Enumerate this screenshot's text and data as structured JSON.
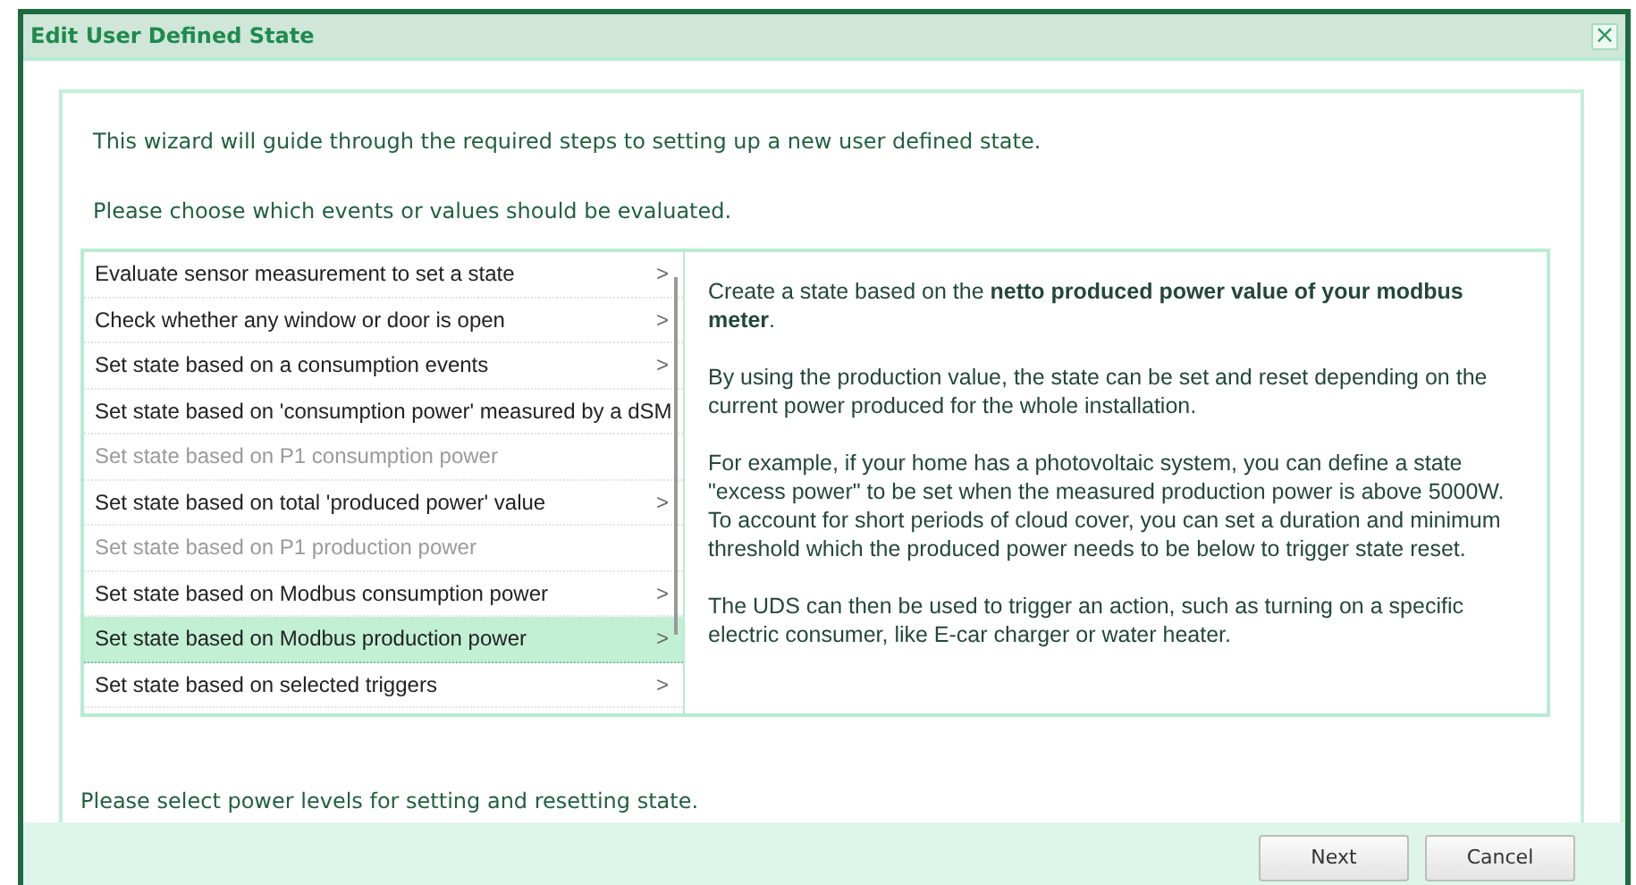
{
  "window": {
    "title": "Edit User Defined State",
    "close": "×"
  },
  "intro": "This wizard will guide through the required steps to setting up a new user defined state.",
  "prompt": "Please choose which events or values should be evaluated.",
  "options": [
    {
      "label": "Evaluate sensor measurement to set a state",
      "arrow": ">",
      "disabled": false,
      "selected": false
    },
    {
      "label": "Check whether any window or door is open",
      "arrow": ">",
      "disabled": false,
      "selected": false
    },
    {
      "label": "Set state based on a consumption events",
      "arrow": ">",
      "disabled": false,
      "selected": false
    },
    {
      "label": "Set state based on 'consumption power' measured by a dSM",
      "disabled": false,
      "selected": false
    },
    {
      "label": "Set state based on P1 consumption power",
      "disabled": true,
      "selected": false
    },
    {
      "label": "Set state based on total 'produced power' value",
      "arrow": ">",
      "disabled": false,
      "selected": false
    },
    {
      "label": "Set state based on P1 production power",
      "disabled": true,
      "selected": false
    },
    {
      "label": "Set state based on Modbus consumption power",
      "arrow": ">",
      "disabled": false,
      "selected": false
    },
    {
      "label": "Set state based on Modbus production power",
      "arrow": ">",
      "disabled": false,
      "selected": true
    },
    {
      "label": "Set state based on selected triggers",
      "arrow": ">",
      "disabled": false,
      "selected": false
    }
  ],
  "description": [
    "Create a state based on the **netto produced power value of your modbus meter**.",
    "By using the production value, the state can be set and reset depending on the current power produced for the whole installation.",
    "For example, if your home has a photovoltaic system, you can define a state \"excess power\" to be set when the measured production power is above 5000W. To account for short periods of cloud cover, you can set a duration and minimum threshold which the produced power needs to be below to trigger state reset.",
    "The UDS can then be used to trigger an action, such as turning on a specific electric consumer, like E-car charger or water heater."
  ],
  "next_step": "Please select power levels for setting and resetting state.",
  "buttons": [
    "Next",
    "Cancel"
  ]
}
